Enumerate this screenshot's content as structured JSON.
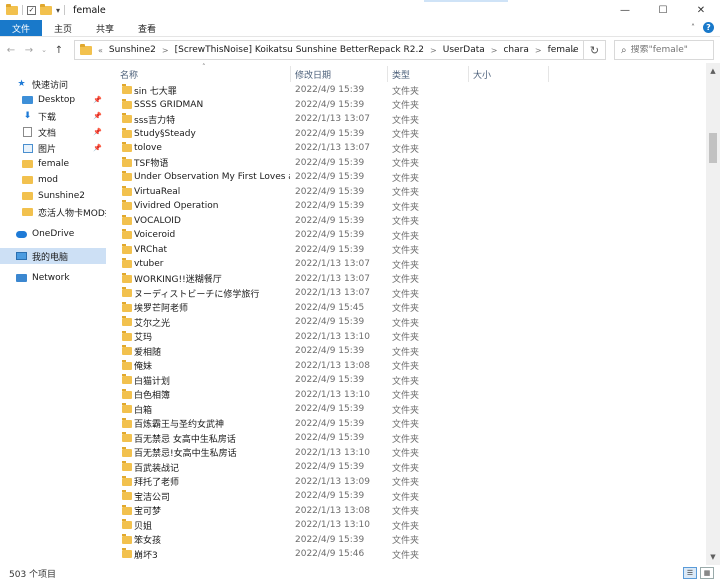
{
  "window": {
    "title": "female",
    "controls": {
      "minimize": "—",
      "maximize": "☐",
      "close": "✕"
    }
  },
  "ribbon": {
    "tabs": [
      "文件",
      "主页",
      "共享",
      "查看"
    ],
    "help": "?",
    "collapse": "˄"
  },
  "address": {
    "breadcrumb": [
      "Sunshine2",
      "[ScrewThisNoise] Koikatsu Sunshine BetterRepack R2.2",
      "UserData",
      "chara",
      "female"
    ],
    "search_placeholder": "搜索\"female\""
  },
  "columns": {
    "name": "名称",
    "date": "修改日期",
    "type": "类型",
    "size": "大小"
  },
  "navpane": {
    "quick_access": "快速访问",
    "items": [
      {
        "label": "Desktop",
        "icon": "desktop-icon",
        "pinned": true
      },
      {
        "label": "下载",
        "icon": "download-icon",
        "pinned": true
      },
      {
        "label": "文档",
        "icon": "document-icon",
        "pinned": true
      },
      {
        "label": "图片",
        "icon": "picture-icon",
        "pinned": true
      },
      {
        "label": "female",
        "icon": "folder-icon",
        "pinned": false
      },
      {
        "label": "mod",
        "icon": "folder-icon",
        "pinned": false
      },
      {
        "label": "Sunshine2",
        "icon": "folder-icon",
        "pinned": false
      },
      {
        "label": "恋活人物卡MOD插",
        "icon": "folder-icon",
        "pinned": false
      }
    ],
    "onedrive": "OneDrive",
    "this_pc": "我的电脑",
    "network": "Network"
  },
  "files": [
    {
      "name": "sin 七大罪",
      "date": "2022/4/9 15:39",
      "type": "文件夹"
    },
    {
      "name": "SSSS GRIDMAN",
      "date": "2022/4/9 15:39",
      "type": "文件夹"
    },
    {
      "name": "sss吉力特",
      "date": "2022/1/13 13:07",
      "type": "文件夹"
    },
    {
      "name": "Study§Steady",
      "date": "2022/4/9 15:39",
      "type": "文件夹"
    },
    {
      "name": "tolove",
      "date": "2022/1/13 13:07",
      "type": "文件夹"
    },
    {
      "name": "TSF物语",
      "date": "2022/4/9 15:39",
      "type": "文件夹"
    },
    {
      "name": "Under Observation My First Loves an...",
      "date": "2022/4/9 15:39",
      "type": "文件夹"
    },
    {
      "name": "VirtuaReal",
      "date": "2022/4/9 15:39",
      "type": "文件夹"
    },
    {
      "name": "Vividred Operation",
      "date": "2022/4/9 15:39",
      "type": "文件夹"
    },
    {
      "name": "VOCALOID",
      "date": "2022/4/9 15:39",
      "type": "文件夹"
    },
    {
      "name": "Voiceroid",
      "date": "2022/4/9 15:39",
      "type": "文件夹"
    },
    {
      "name": "VRChat",
      "date": "2022/4/9 15:39",
      "type": "文件夹"
    },
    {
      "name": "vtuber",
      "date": "2022/1/13 13:07",
      "type": "文件夹"
    },
    {
      "name": "WORKING!!迷糊餐厅",
      "date": "2022/1/13 13:07",
      "type": "文件夹"
    },
    {
      "name": "ヌーディストビーチに修学旅行",
      "date": "2022/1/13 13:07",
      "type": "文件夹"
    },
    {
      "name": "埃罗芒阿老师",
      "date": "2022/4/9 15:45",
      "type": "文件夹"
    },
    {
      "name": "艾尔之光",
      "date": "2022/4/9 15:39",
      "type": "文件夹"
    },
    {
      "name": "艾玛",
      "date": "2022/1/13 13:10",
      "type": "文件夹"
    },
    {
      "name": "爱相随",
      "date": "2022/4/9 15:39",
      "type": "文件夹"
    },
    {
      "name": "俺妹",
      "date": "2022/1/13 13:08",
      "type": "文件夹"
    },
    {
      "name": "白猫计划",
      "date": "2022/4/9 15:39",
      "type": "文件夹"
    },
    {
      "name": "白色相簿",
      "date": "2022/1/13 13:10",
      "type": "文件夹"
    },
    {
      "name": "白箱",
      "date": "2022/4/9 15:39",
      "type": "文件夹"
    },
    {
      "name": "百炼霸王与圣约女武神",
      "date": "2022/4/9 15:39",
      "type": "文件夹"
    },
    {
      "name": "百无禁忌 女高中生私房话",
      "date": "2022/4/9 15:39",
      "type": "文件夹"
    },
    {
      "name": "百无禁忌!女高中生私房话",
      "date": "2022/1/13 13:10",
      "type": "文件夹"
    },
    {
      "name": "百武装战记",
      "date": "2022/4/9 15:39",
      "type": "文件夹"
    },
    {
      "name": "拜托了老师",
      "date": "2022/1/13 13:09",
      "type": "文件夹"
    },
    {
      "name": "宝洁公司",
      "date": "2022/4/9 15:39",
      "type": "文件夹"
    },
    {
      "name": "宝可梦",
      "date": "2022/1/13 13:08",
      "type": "文件夹"
    },
    {
      "name": "贝姐",
      "date": "2022/1/13 13:10",
      "type": "文件夹"
    },
    {
      "name": "笨女孩",
      "date": "2022/4/9 15:39",
      "type": "文件夹"
    },
    {
      "name": "崩坏3",
      "date": "2022/4/9 15:46",
      "type": "文件夹"
    }
  ],
  "status": {
    "item_count": "503 个项目"
  },
  "colors": {
    "accent": "#1979ca",
    "folder": "#f2c14e",
    "selected": "#cde0f5"
  }
}
